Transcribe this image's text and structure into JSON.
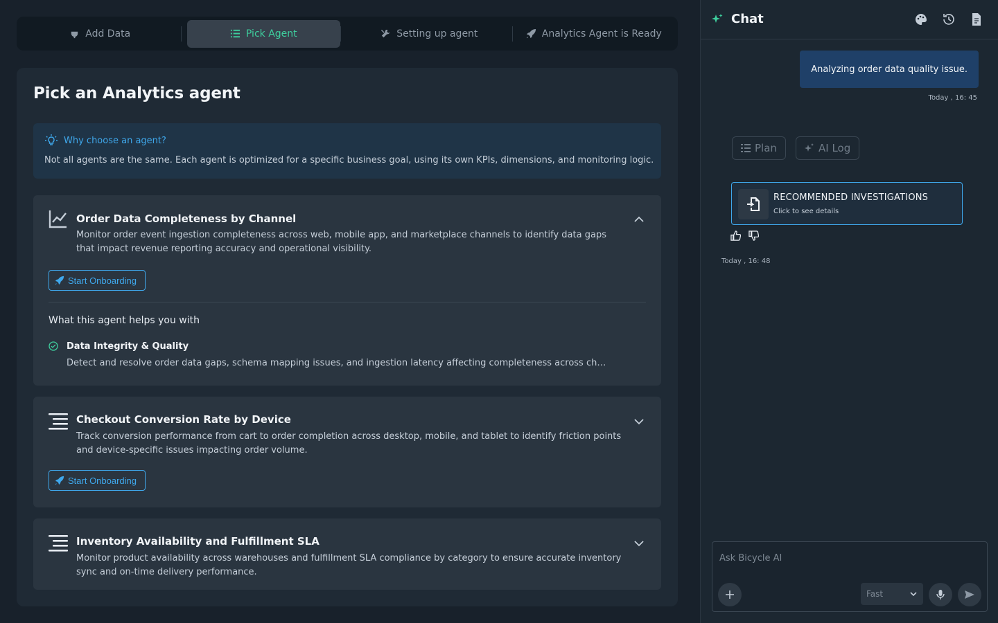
{
  "stepper": {
    "steps": [
      {
        "label": "Add Data",
        "icon": "plug-icon",
        "active": false
      },
      {
        "label": "Pick Agent",
        "icon": "list-icon",
        "active": true
      },
      {
        "label": "Setting up agent",
        "icon": "tools-icon",
        "active": false
      },
      {
        "label": "Analytics Agent is Ready",
        "icon": "rocket-icon",
        "active": false
      }
    ]
  },
  "main": {
    "title": "Pick an Analytics agent",
    "info": {
      "heading": "Why choose an agent?",
      "body": "Not all agents are the same. Each agent is optimized for a specific business goal, using its own KPIs, dimensions, and monitoring logic."
    },
    "agents": [
      {
        "title": "Order Data Completeness by Channel",
        "description": "Monitor order event ingestion completeness across web, mobile app, and marketplace channels to identify data gaps that impact revenue reporting accuracy and operational visibility.",
        "button": "Start Onboarding",
        "expanded": true,
        "helps_heading": "What this agent helps you with",
        "feature_title": "Data Integrity & Quality",
        "feature_desc": "Detect and resolve order data gaps, schema mapping issues, and ingestion latency affecting completeness across chann..."
      },
      {
        "title": "Checkout Conversion Rate by Device",
        "description": "Track conversion performance from cart to order completion across desktop, mobile, and tablet to identify friction points and device-specific issues impacting order volume.",
        "button": "Start Onboarding",
        "expanded": false
      },
      {
        "title": "Inventory Availability and Fulfillment SLA",
        "description": "Monitor product availability across warehouses and fulfillment SLA compliance by category to ensure accurate inventory sync and on-time delivery performance.",
        "expanded": false
      }
    ]
  },
  "chat": {
    "title": "Chat",
    "user_message": "Analyzing order data quality issue.",
    "user_time": "Today , 16: 45",
    "tabs": {
      "plan": "Plan",
      "ai_log": "AI Log"
    },
    "recommendation": {
      "title": "RECOMMENDED INVESTIGATIONS",
      "subtitle": "Click to see details"
    },
    "ai_time": "Today , 16: 48",
    "composer": {
      "placeholder": "Ask Bicycle AI",
      "mode": "Fast"
    }
  },
  "colors": {
    "accent_green": "#3ecf9e",
    "accent_blue": "#3fa8ec",
    "bubble": "#1f4068"
  }
}
